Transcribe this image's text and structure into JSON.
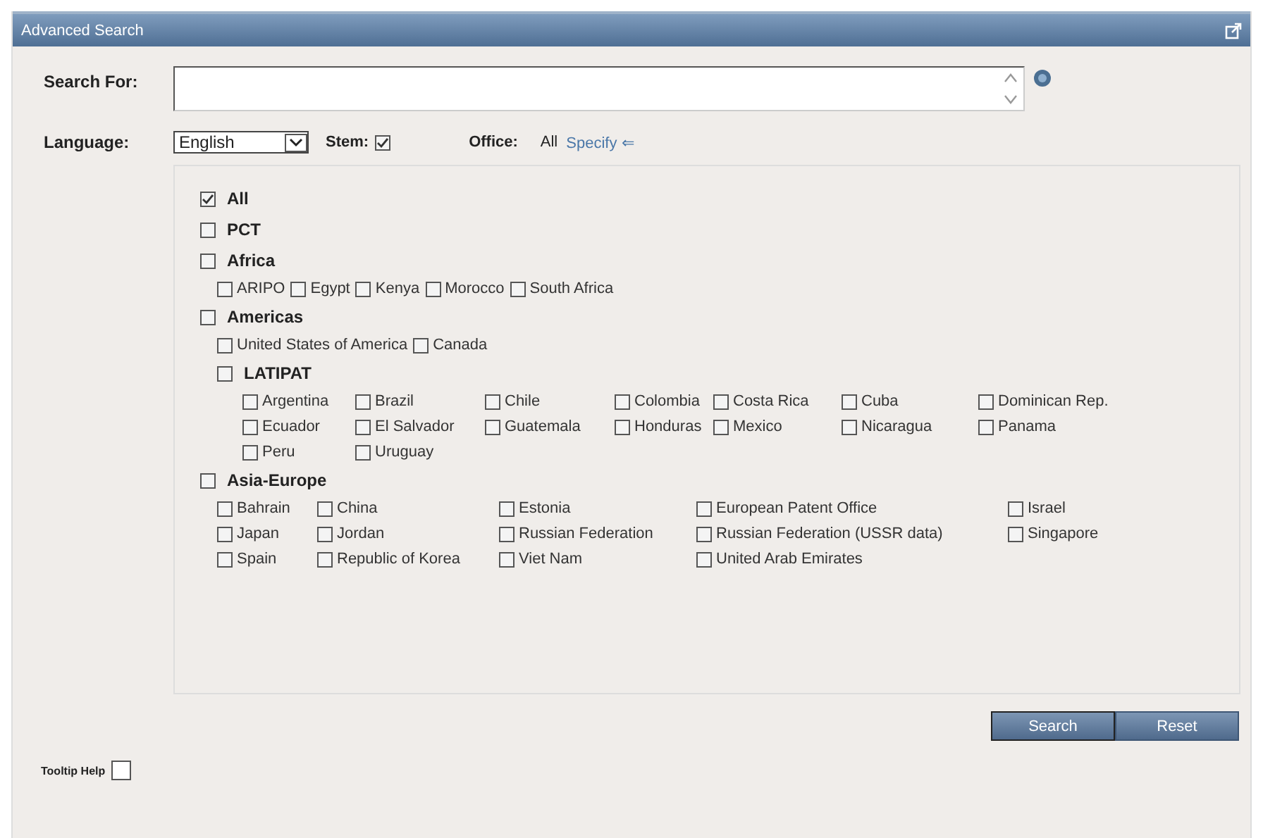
{
  "window": {
    "title": "Advanced Search"
  },
  "search_for": {
    "label": "Search For:"
  },
  "language": {
    "label": "Language:",
    "value": "English"
  },
  "stem": {
    "label": "Stem:",
    "checked": true
  },
  "office": {
    "label": "Office:",
    "value": "All",
    "link": "Specify ⇐"
  },
  "offices": [
    {
      "label": "All",
      "checked": true
    },
    {
      "label": "PCT",
      "checked": false
    },
    {
      "label": "Africa",
      "checked": false,
      "children": [
        {
          "label": "ARIPO",
          "checked": false
        },
        {
          "label": "Egypt",
          "checked": false
        },
        {
          "label": "Kenya",
          "checked": false
        },
        {
          "label": "Morocco",
          "checked": false
        },
        {
          "label": "South Africa",
          "checked": false
        }
      ]
    },
    {
      "label": "Americas",
      "checked": false,
      "children": [
        {
          "label": "United States of America",
          "checked": false
        },
        {
          "label": "Canada",
          "checked": false
        },
        {
          "label": "LATIPAT",
          "checked": false,
          "children": [
            {
              "label": "Argentina",
              "checked": false
            },
            {
              "label": "Brazil",
              "checked": false
            },
            {
              "label": "Chile",
              "checked": false
            },
            {
              "label": "Colombia",
              "checked": false
            },
            {
              "label": "Costa Rica",
              "checked": false
            },
            {
              "label": "Cuba",
              "checked": false
            },
            {
              "label": "Dominican Rep.",
              "checked": false
            },
            {
              "label": "Ecuador",
              "checked": false
            },
            {
              "label": "El Salvador",
              "checked": false
            },
            {
              "label": "Guatemala",
              "checked": false
            },
            {
              "label": "Honduras",
              "checked": false
            },
            {
              "label": "Mexico",
              "checked": false
            },
            {
              "label": "Nicaragua",
              "checked": false
            },
            {
              "label": "Panama",
              "checked": false
            },
            {
              "label": "Peru",
              "checked": false
            },
            {
              "label": "Uruguay",
              "checked": false
            }
          ]
        }
      ]
    },
    {
      "label": "Asia-Europe",
      "checked": false,
      "children": [
        {
          "label": "Bahrain",
          "checked": false
        },
        {
          "label": "China",
          "checked": false
        },
        {
          "label": "Estonia",
          "checked": false
        },
        {
          "label": "European Patent Office",
          "checked": false
        },
        {
          "label": "Israel",
          "checked": false
        },
        {
          "label": "Japan",
          "checked": false
        },
        {
          "label": "Jordan",
          "checked": false
        },
        {
          "label": "Russian Federation",
          "checked": false
        },
        {
          "label": "Russian Federation (USSR data)",
          "checked": false
        },
        {
          "label": "Singapore",
          "checked": false
        },
        {
          "label": "Spain",
          "checked": false
        },
        {
          "label": "Republic of Korea",
          "checked": false
        },
        {
          "label": "Viet Nam",
          "checked": false
        },
        {
          "label": "United Arab Emirates",
          "checked": false
        }
      ]
    }
  ],
  "buttons": [
    {
      "label": "Search",
      "selected": true
    },
    {
      "label": "Reset",
      "selected": false
    }
  ],
  "tooltip_help": {
    "label": "Tooltip Help",
    "checked": false
  }
}
